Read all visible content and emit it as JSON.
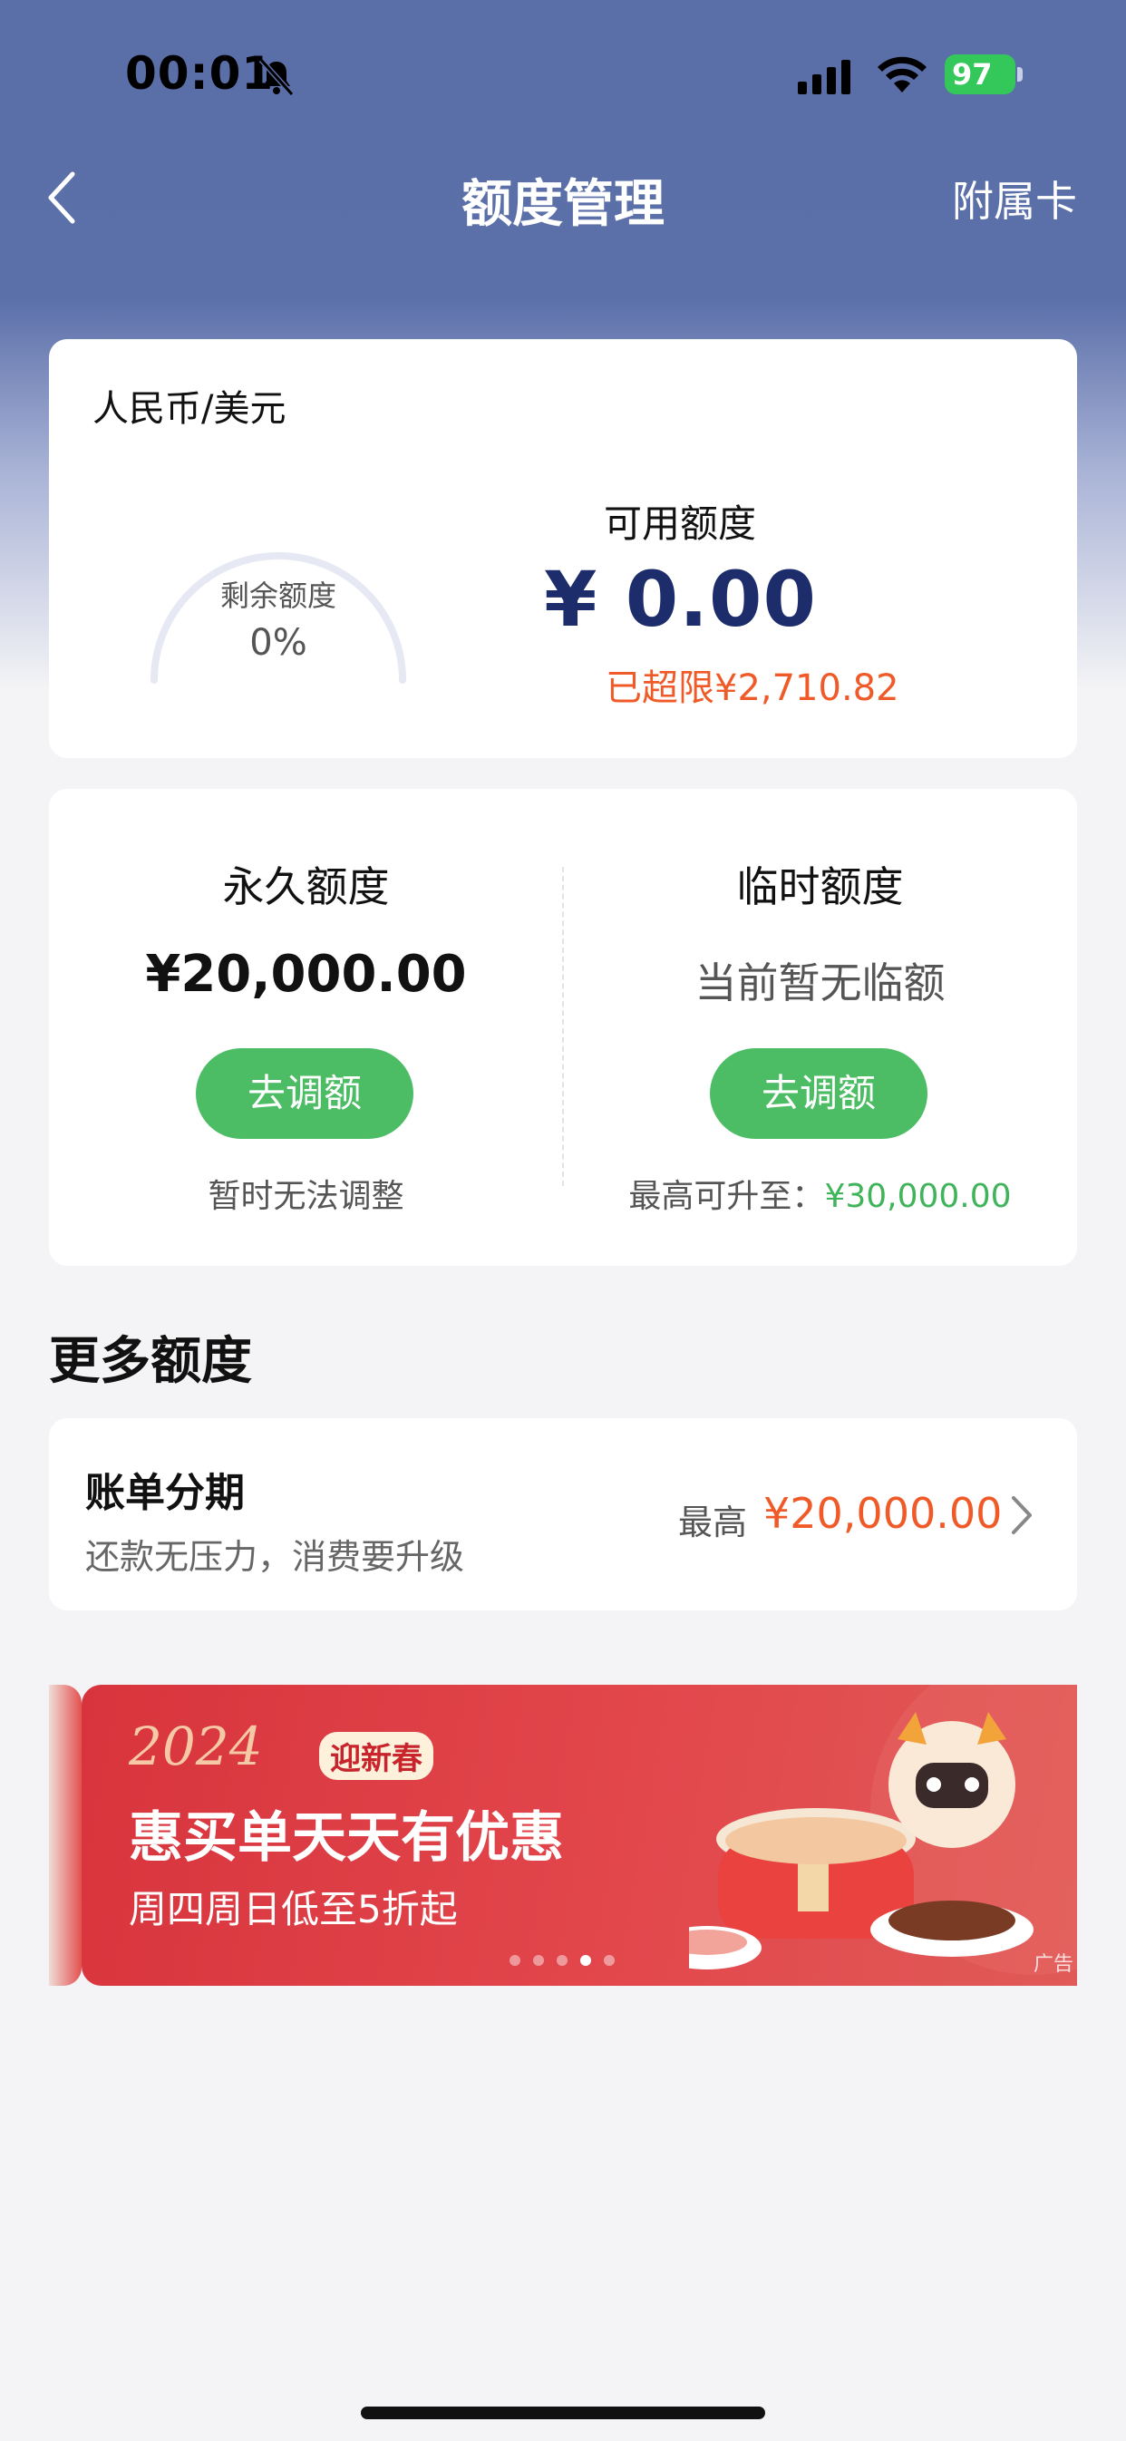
{
  "status_bar": {
    "time": "00:01",
    "battery": "97"
  },
  "nav": {
    "title": "额度管理",
    "right_label": "附属卡"
  },
  "overview": {
    "currency": "人民币/美元",
    "gauge_label": "剩余额度",
    "gauge_value": "0%",
    "gauge_percent": 0,
    "available_label": "可用额度",
    "available_amount": "¥ 0.00",
    "overlimit": "已超限¥2,710.82"
  },
  "limits": {
    "permanent": {
      "title": "永久额度",
      "value": "¥20,000.00",
      "button": "去调额",
      "note": "暂时无法调整"
    },
    "temporary": {
      "title": "临时额度",
      "value": "当前暂无临额",
      "button": "去调额",
      "note_label": "最高可升至：",
      "note_value": "¥30,000.00"
    }
  },
  "more": {
    "section_title": "更多额度",
    "installment": {
      "title": "账单分期",
      "subtitle": "还款无压力，消费要升级",
      "max_label": "最高",
      "max_value": "¥20,000.00"
    }
  },
  "banner": {
    "year": "2024",
    "tag": "迎新春",
    "title": "惠买单天天有优惠",
    "subtitle": "周四周日低至5折起",
    "ad_mark": "广告",
    "dots_count": 5,
    "active_dot": 3
  },
  "colors": {
    "header_blue": "#5a6ea8",
    "amount_navy": "#1d2c6b",
    "warning_orange": "#f05a28",
    "button_green": "#4cbd64"
  }
}
